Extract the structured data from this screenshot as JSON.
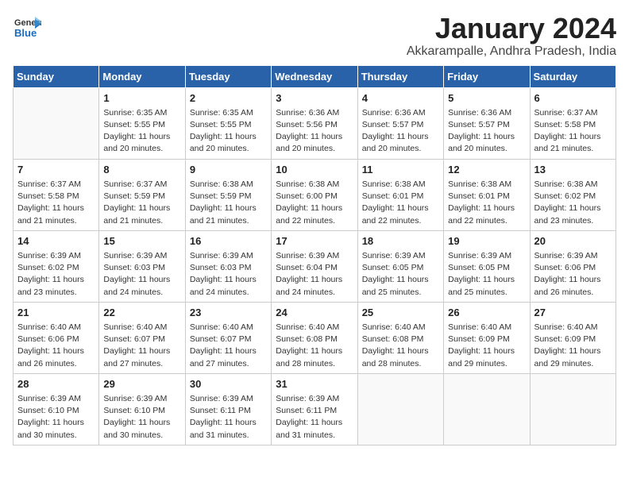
{
  "header": {
    "logo_line1": "General",
    "logo_line2": "Blue",
    "title": "January 2024",
    "subtitle": "Akkarampalle, Andhra Pradesh, India"
  },
  "weekdays": [
    "Sunday",
    "Monday",
    "Tuesday",
    "Wednesday",
    "Thursday",
    "Friday",
    "Saturday"
  ],
  "weeks": [
    [
      {
        "day": "",
        "info": ""
      },
      {
        "day": "1",
        "info": "Sunrise: 6:35 AM\nSunset: 5:55 PM\nDaylight: 11 hours\nand 20 minutes."
      },
      {
        "day": "2",
        "info": "Sunrise: 6:35 AM\nSunset: 5:55 PM\nDaylight: 11 hours\nand 20 minutes."
      },
      {
        "day": "3",
        "info": "Sunrise: 6:36 AM\nSunset: 5:56 PM\nDaylight: 11 hours\nand 20 minutes."
      },
      {
        "day": "4",
        "info": "Sunrise: 6:36 AM\nSunset: 5:57 PM\nDaylight: 11 hours\nand 20 minutes."
      },
      {
        "day": "5",
        "info": "Sunrise: 6:36 AM\nSunset: 5:57 PM\nDaylight: 11 hours\nand 20 minutes."
      },
      {
        "day": "6",
        "info": "Sunrise: 6:37 AM\nSunset: 5:58 PM\nDaylight: 11 hours\nand 21 minutes."
      }
    ],
    [
      {
        "day": "7",
        "info": "Sunrise: 6:37 AM\nSunset: 5:58 PM\nDaylight: 11 hours\nand 21 minutes."
      },
      {
        "day": "8",
        "info": "Sunrise: 6:37 AM\nSunset: 5:59 PM\nDaylight: 11 hours\nand 21 minutes."
      },
      {
        "day": "9",
        "info": "Sunrise: 6:38 AM\nSunset: 5:59 PM\nDaylight: 11 hours\nand 21 minutes."
      },
      {
        "day": "10",
        "info": "Sunrise: 6:38 AM\nSunset: 6:00 PM\nDaylight: 11 hours\nand 22 minutes."
      },
      {
        "day": "11",
        "info": "Sunrise: 6:38 AM\nSunset: 6:01 PM\nDaylight: 11 hours\nand 22 minutes."
      },
      {
        "day": "12",
        "info": "Sunrise: 6:38 AM\nSunset: 6:01 PM\nDaylight: 11 hours\nand 22 minutes."
      },
      {
        "day": "13",
        "info": "Sunrise: 6:38 AM\nSunset: 6:02 PM\nDaylight: 11 hours\nand 23 minutes."
      }
    ],
    [
      {
        "day": "14",
        "info": "Sunrise: 6:39 AM\nSunset: 6:02 PM\nDaylight: 11 hours\nand 23 minutes."
      },
      {
        "day": "15",
        "info": "Sunrise: 6:39 AM\nSunset: 6:03 PM\nDaylight: 11 hours\nand 24 minutes."
      },
      {
        "day": "16",
        "info": "Sunrise: 6:39 AM\nSunset: 6:03 PM\nDaylight: 11 hours\nand 24 minutes."
      },
      {
        "day": "17",
        "info": "Sunrise: 6:39 AM\nSunset: 6:04 PM\nDaylight: 11 hours\nand 24 minutes."
      },
      {
        "day": "18",
        "info": "Sunrise: 6:39 AM\nSunset: 6:05 PM\nDaylight: 11 hours\nand 25 minutes."
      },
      {
        "day": "19",
        "info": "Sunrise: 6:39 AM\nSunset: 6:05 PM\nDaylight: 11 hours\nand 25 minutes."
      },
      {
        "day": "20",
        "info": "Sunrise: 6:39 AM\nSunset: 6:06 PM\nDaylight: 11 hours\nand 26 minutes."
      }
    ],
    [
      {
        "day": "21",
        "info": "Sunrise: 6:40 AM\nSunset: 6:06 PM\nDaylight: 11 hours\nand 26 minutes."
      },
      {
        "day": "22",
        "info": "Sunrise: 6:40 AM\nSunset: 6:07 PM\nDaylight: 11 hours\nand 27 minutes."
      },
      {
        "day": "23",
        "info": "Sunrise: 6:40 AM\nSunset: 6:07 PM\nDaylight: 11 hours\nand 27 minutes."
      },
      {
        "day": "24",
        "info": "Sunrise: 6:40 AM\nSunset: 6:08 PM\nDaylight: 11 hours\nand 28 minutes."
      },
      {
        "day": "25",
        "info": "Sunrise: 6:40 AM\nSunset: 6:08 PM\nDaylight: 11 hours\nand 28 minutes."
      },
      {
        "day": "26",
        "info": "Sunrise: 6:40 AM\nSunset: 6:09 PM\nDaylight: 11 hours\nand 29 minutes."
      },
      {
        "day": "27",
        "info": "Sunrise: 6:40 AM\nSunset: 6:09 PM\nDaylight: 11 hours\nand 29 minutes."
      }
    ],
    [
      {
        "day": "28",
        "info": "Sunrise: 6:39 AM\nSunset: 6:10 PM\nDaylight: 11 hours\nand 30 minutes."
      },
      {
        "day": "29",
        "info": "Sunrise: 6:39 AM\nSunset: 6:10 PM\nDaylight: 11 hours\nand 30 minutes."
      },
      {
        "day": "30",
        "info": "Sunrise: 6:39 AM\nSunset: 6:11 PM\nDaylight: 11 hours\nand 31 minutes."
      },
      {
        "day": "31",
        "info": "Sunrise: 6:39 AM\nSunset: 6:11 PM\nDaylight: 11 hours\nand 31 minutes."
      },
      {
        "day": "",
        "info": ""
      },
      {
        "day": "",
        "info": ""
      },
      {
        "day": "",
        "info": ""
      }
    ]
  ]
}
